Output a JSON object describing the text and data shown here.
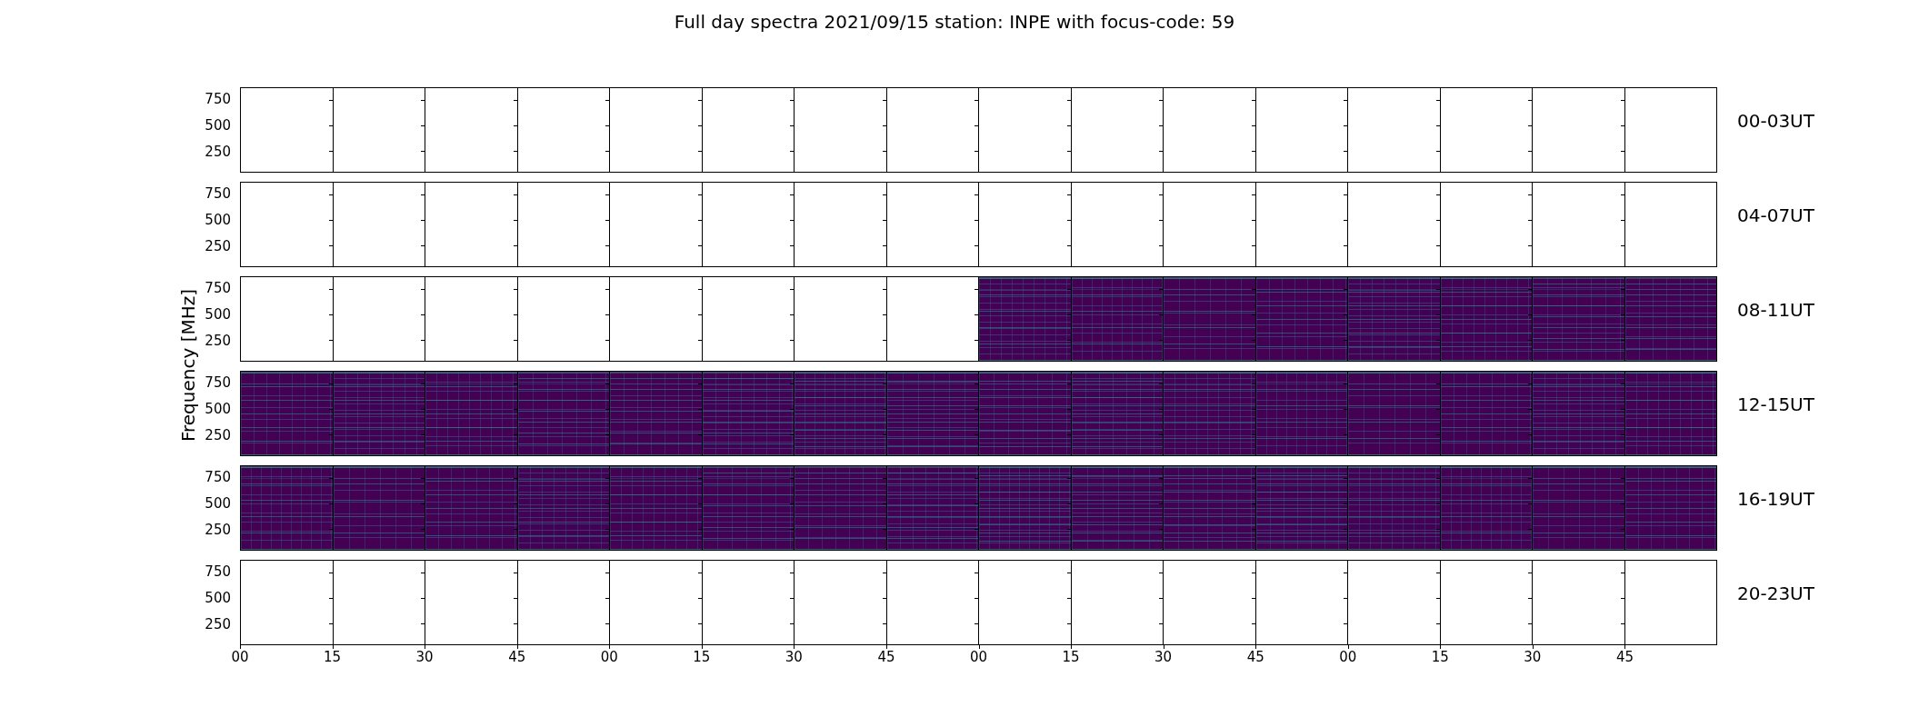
{
  "title": "Full day spectra 2021/09/15 station: INPE with focus-code: 59",
  "ylabel": "Frequency [MHz]",
  "rows": [
    {
      "label": "00-03UT",
      "y_ticks": [
        "750",
        "500",
        "250"
      ],
      "panels": [
        {
          "has_data": false
        },
        {
          "has_data": false
        },
        {
          "has_data": false
        },
        {
          "has_data": false
        },
        {
          "has_data": false
        },
        {
          "has_data": false
        },
        {
          "has_data": false
        },
        {
          "has_data": false
        },
        {
          "has_data": false
        },
        {
          "has_data": false
        },
        {
          "has_data": false
        },
        {
          "has_data": false
        },
        {
          "has_data": false
        },
        {
          "has_data": false
        },
        {
          "has_data": false
        },
        {
          "has_data": false
        }
      ]
    },
    {
      "label": "04-07UT",
      "y_ticks": [
        "750",
        "500",
        "250"
      ],
      "panels": [
        {
          "has_data": false
        },
        {
          "has_data": false
        },
        {
          "has_data": false
        },
        {
          "has_data": false
        },
        {
          "has_data": false
        },
        {
          "has_data": false
        },
        {
          "has_data": false
        },
        {
          "has_data": false
        },
        {
          "has_data": false
        },
        {
          "has_data": false
        },
        {
          "has_data": false
        },
        {
          "has_data": false
        },
        {
          "has_data": false
        },
        {
          "has_data": false
        },
        {
          "has_data": false
        },
        {
          "has_data": false
        }
      ]
    },
    {
      "label": "08-11UT",
      "y_ticks": [
        "750",
        "500",
        "250"
      ],
      "panels": [
        {
          "has_data": false
        },
        {
          "has_data": false
        },
        {
          "has_data": false
        },
        {
          "has_data": false
        },
        {
          "has_data": false
        },
        {
          "has_data": false
        },
        {
          "has_data": false
        },
        {
          "has_data": false
        },
        {
          "has_data": true
        },
        {
          "has_data": true
        },
        {
          "has_data": true
        },
        {
          "has_data": true
        },
        {
          "has_data": true
        },
        {
          "has_data": true
        },
        {
          "has_data": true
        },
        {
          "has_data": true
        }
      ]
    },
    {
      "label": "12-15UT",
      "y_ticks": [
        "750",
        "500",
        "250"
      ],
      "panels": [
        {
          "has_data": true
        },
        {
          "has_data": true
        },
        {
          "has_data": true
        },
        {
          "has_data": true
        },
        {
          "has_data": true
        },
        {
          "has_data": true
        },
        {
          "has_data": true
        },
        {
          "has_data": true
        },
        {
          "has_data": true
        },
        {
          "has_data": true
        },
        {
          "has_data": true
        },
        {
          "has_data": true
        },
        {
          "has_data": true
        },
        {
          "has_data": true
        },
        {
          "has_data": true
        },
        {
          "has_data": true
        }
      ]
    },
    {
      "label": "16-19UT",
      "y_ticks": [
        "750",
        "500",
        "250"
      ],
      "panels": [
        {
          "has_data": true
        },
        {
          "has_data": true
        },
        {
          "has_data": true
        },
        {
          "has_data": true
        },
        {
          "has_data": true
        },
        {
          "has_data": true
        },
        {
          "has_data": true
        },
        {
          "has_data": true
        },
        {
          "has_data": true
        },
        {
          "has_data": true
        },
        {
          "has_data": true
        },
        {
          "has_data": true
        },
        {
          "has_data": true
        },
        {
          "has_data": true
        },
        {
          "has_data": true
        },
        {
          "has_data": true
        }
      ]
    },
    {
      "label": "20-23UT",
      "y_ticks": [
        "750",
        "500",
        "250"
      ],
      "panels": [
        {
          "has_data": false
        },
        {
          "has_data": false
        },
        {
          "has_data": false
        },
        {
          "has_data": false
        },
        {
          "has_data": false
        },
        {
          "has_data": false
        },
        {
          "has_data": false
        },
        {
          "has_data": false
        },
        {
          "has_data": false
        },
        {
          "has_data": false
        },
        {
          "has_data": false
        },
        {
          "has_data": false
        },
        {
          "has_data": false
        },
        {
          "has_data": false
        },
        {
          "has_data": false
        },
        {
          "has_data": false
        }
      ]
    }
  ],
  "x_ticks": [
    "00",
    "15",
    "30",
    "45",
    "00",
    "15",
    "30",
    "45",
    "00",
    "15",
    "30",
    "45",
    "00",
    "15",
    "30",
    "45"
  ]
}
